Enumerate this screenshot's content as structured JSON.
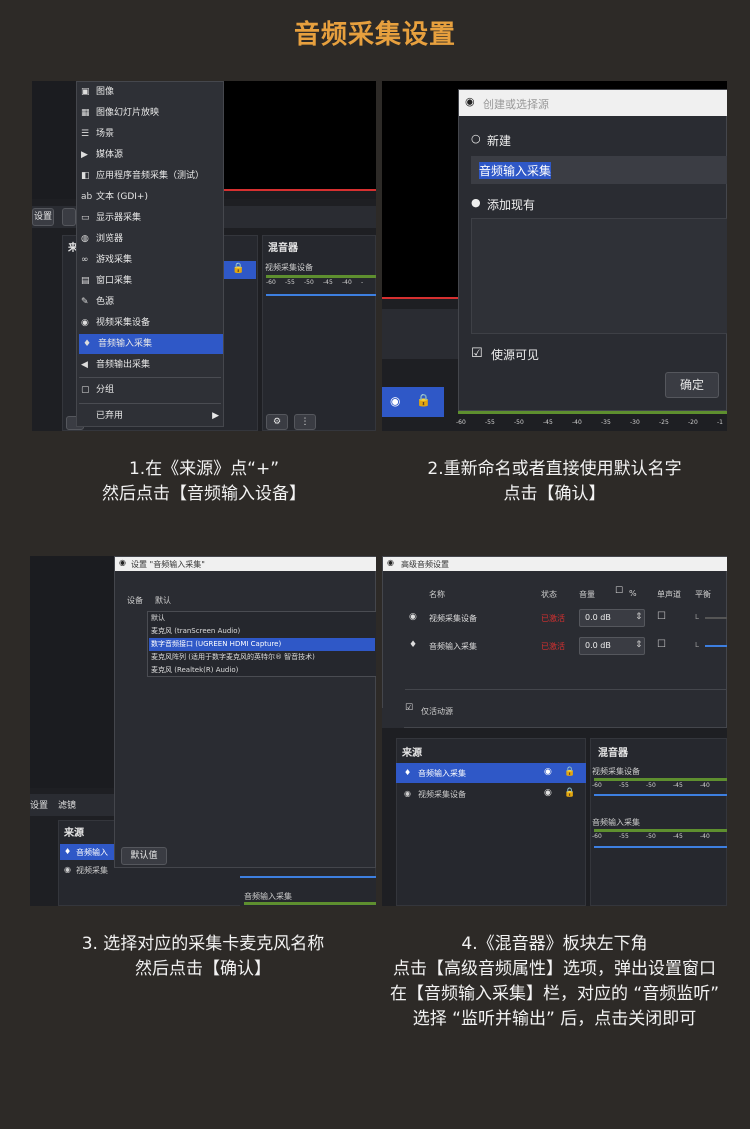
{
  "title": "音频采集设置",
  "step1": {
    "menu_items": [
      {
        "icon": "image-icon",
        "glyph": "▣",
        "label": "图像"
      },
      {
        "icon": "slideshow-icon",
        "glyph": "▦",
        "label": "图像幻灯片放映"
      },
      {
        "icon": "list-icon",
        "glyph": "☰",
        "label": "场景"
      },
      {
        "icon": "play-icon",
        "glyph": "▶",
        "label": "媒体源"
      },
      {
        "icon": "app-audio-icon",
        "glyph": "◧",
        "label": "应用程序音频采集（测试）"
      },
      {
        "icon": "text-icon",
        "glyph": "ab",
        "label": "文本 (GDI+)"
      },
      {
        "icon": "monitor-icon",
        "glyph": "▭",
        "label": "显示器采集"
      },
      {
        "icon": "globe-icon",
        "glyph": "◍",
        "label": "浏览器"
      },
      {
        "icon": "gamepad-icon",
        "glyph": "∞",
        "label": "游戏采集"
      },
      {
        "icon": "window-icon",
        "glyph": "▤",
        "label": "窗口采集"
      },
      {
        "icon": "brush-icon",
        "glyph": "✎",
        "label": "色源"
      },
      {
        "icon": "camera-icon",
        "glyph": "◉",
        "label": "视频采集设备"
      },
      {
        "icon": "mic-icon",
        "glyph": "♦",
        "label": "音频输入采集"
      },
      {
        "icon": "speaker-icon",
        "glyph": "◀",
        "label": "音频输出采集"
      },
      {
        "icon": "folder-icon",
        "glyph": "▢",
        "label": "分组"
      },
      {
        "icon": "none",
        "glyph": "",
        "label": "已弃用"
      }
    ],
    "bg_settings": "设置",
    "bg_sources": "来",
    "mixer_title": "混音器",
    "mixer_item": "视频采集设备",
    "ticks": [
      "-60",
      "-55",
      "-50",
      "-45",
      "-40",
      "-"
    ],
    "caption_l1": "1.在《来源》点“+”",
    "caption_l2": "然后点击【音频输入设备】"
  },
  "step2": {
    "dialog_title": "创建或选择源",
    "new_label": "新建",
    "name_value": "音频输入采集",
    "existing_label": "添加现有",
    "visible_label": "使源可见",
    "ok_label": "确定",
    "ticks": [
      "-60",
      "-55",
      "-50",
      "-45",
      "-40",
      "-35",
      "-30",
      "-25",
      "-20",
      "-1"
    ],
    "caption_l1": "2.重新命名或者直接使用默认名字",
    "caption_l2": "点击【确认】"
  },
  "step3": {
    "win_title": "设置 \"音频输入采集\"",
    "tab_device": "设备",
    "tab_default": "默认",
    "options": [
      "默认",
      "麦克风 (tranScreen Audio)",
      "数字音频接口 (UGREEN HDMI Capture)",
      "麦克风阵列 (适用于数字麦克风的英特尔® 智音技术)",
      "麦克风 (Realtek(R) Audio)"
    ],
    "default_btn": "默认值",
    "bg_settings": "设置",
    "bg_filter": "滤镜",
    "bg_sources": "来源",
    "bg_src1": "音频输入",
    "bg_src2": "视频采集",
    "bg_mixer_item": "音频输入采集",
    "caption_l1": "3. 选择对应的采集卡麦克风名称",
    "caption_l2": "然后点击【确认】"
  },
  "step4": {
    "win_title": "高级音频设置",
    "col_name": "名称",
    "col_status": "状态",
    "col_volume": "音量",
    "col_percent": "%",
    "col_mono": "单声道",
    "col_balance": "平衡",
    "rows": [
      {
        "name": "视频采集设备",
        "status": "已激活",
        "volume": "0.0 dB",
        "bal": "L"
      },
      {
        "name": "音频输入采集",
        "status": "已激活",
        "volume": "0.0 dB",
        "bal": "L"
      }
    ],
    "only_active": "仅活动源",
    "sources_title": "来源",
    "sources": [
      "音频输入采集",
      "视频采集设备"
    ],
    "mixer_title": "混音器",
    "mixer_items": [
      "视频采集设备",
      "音频输入采集"
    ],
    "ticks": [
      "-60",
      "-55",
      "-50",
      "-45",
      "-40"
    ],
    "caption_l1": "4.《混音器》板块左下角",
    "caption_l2": "点击【高级音频属性】选项，弹出设置窗口",
    "caption_l3": "在【音频输入采集】栏，对应的 “音频监听”",
    "caption_l4": "选择 “监听并输出” 后，点击关闭即可"
  },
  "colors": {
    "accent": "#e7a03e",
    "select": "#2f58c7",
    "background": "#2d2a27"
  }
}
